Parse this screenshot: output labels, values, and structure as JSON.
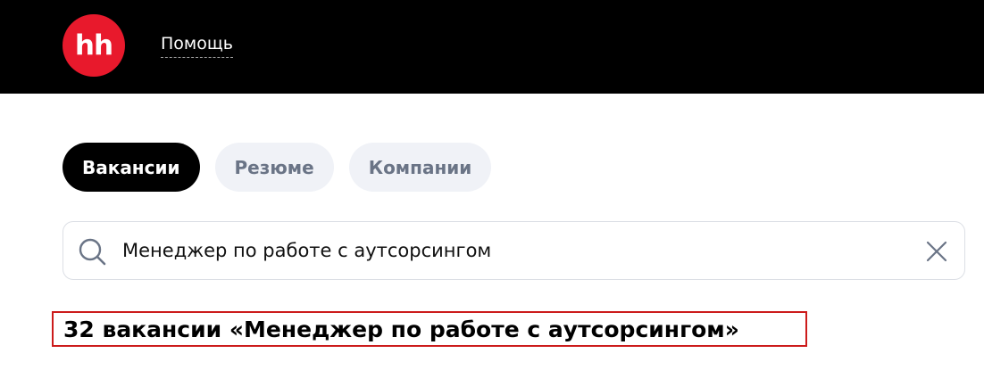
{
  "header": {
    "logo_text": "hh",
    "help_link": "Помощь"
  },
  "tabs": [
    {
      "label": "Вакансии",
      "active": true
    },
    {
      "label": "Резюме",
      "active": false
    },
    {
      "label": "Компании",
      "active": false
    }
  ],
  "search": {
    "value": "Менеджер по работе с аутсорсингом",
    "search_icon": "search-icon",
    "clear_icon": "close-icon"
  },
  "results": {
    "title": "32 вакансии «Менеджер по работе с аутсорсингом»"
  },
  "colors": {
    "header_bg": "#000000",
    "logo_red": "#e8192c",
    "highlight_border": "#cc1b1b"
  }
}
